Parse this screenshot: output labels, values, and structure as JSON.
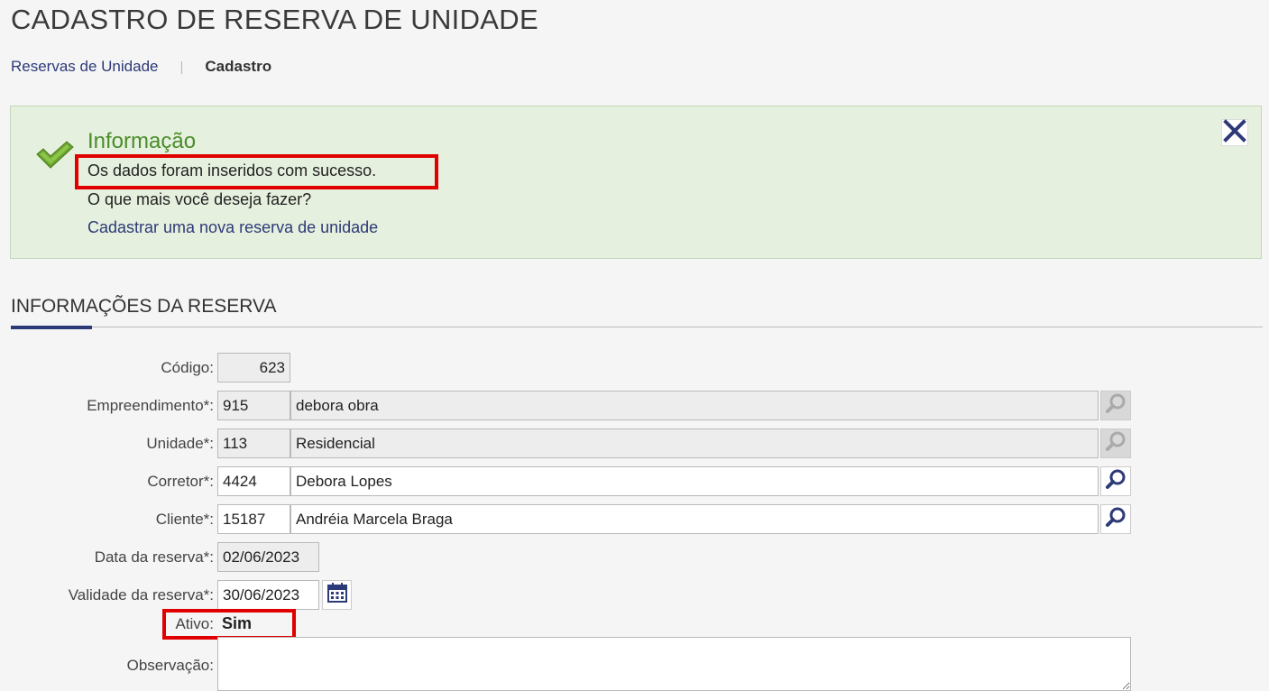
{
  "page_title": "CADASTRO DE RESERVA DE UNIDADE",
  "breadcrumb": {
    "parent": "Reservas de Unidade",
    "separator": "|",
    "current": "Cadastro"
  },
  "info": {
    "title": "Informação",
    "message": "Os dados foram inseridos com sucesso.",
    "question": "O que mais você deseja fazer?",
    "link": "Cadastrar uma nova reserva de unidade"
  },
  "section": {
    "title": "INFORMAÇÕES DA RESERVA"
  },
  "form": {
    "codigo": {
      "label": "Código:",
      "value": "623"
    },
    "empreendimento": {
      "label": "Empreendimento*:",
      "code": "915",
      "name": "debora obra"
    },
    "unidade": {
      "label": "Unidade*:",
      "code": "113",
      "name": "Residencial"
    },
    "corretor": {
      "label": "Corretor*:",
      "code": "4424",
      "name": "Debora Lopes"
    },
    "cliente": {
      "label": "Cliente*:",
      "code": "15187",
      "name": "Andréia Marcela Braga"
    },
    "data_reserva": {
      "label": "Data da reserva*:",
      "value": "02/06/2023"
    },
    "validade_reserva": {
      "label": "Validade da reserva*:",
      "value": "30/06/2023"
    },
    "ativo": {
      "label": "Ativo:",
      "value": "Sim"
    },
    "observacao": {
      "label": "Observação:",
      "value": ""
    }
  },
  "colors": {
    "accent": "#2d3a78",
    "success_bg": "#e6f0de",
    "success_title": "#4a8c2a",
    "highlight": "#e00000"
  },
  "icons": [
    "check-icon",
    "close-icon",
    "search-icon",
    "calendar-icon"
  ]
}
